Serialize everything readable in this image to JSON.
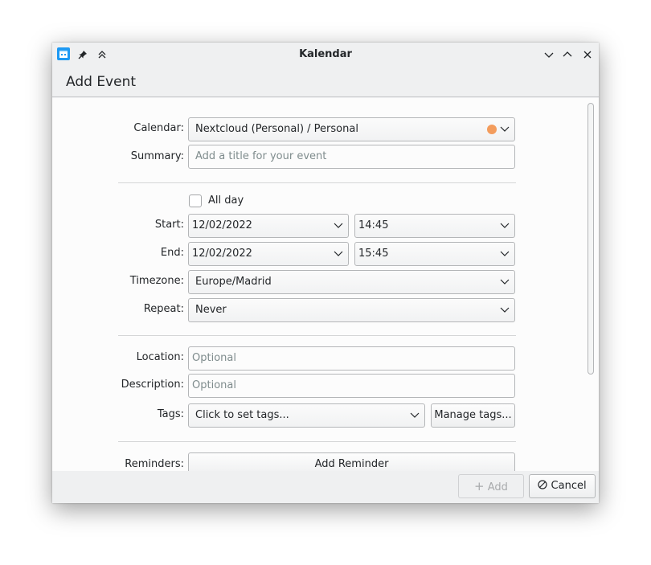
{
  "window": {
    "title": "Kalendar"
  },
  "header": {
    "title": "Add Event"
  },
  "form": {
    "calendar": {
      "label": "Calendar:",
      "value": "Nextcloud (Personal) / Personal",
      "color": "#f39c5c"
    },
    "summary": {
      "label": "Summary:",
      "placeholder": "Add a title for your event"
    },
    "all_day": {
      "label": "All day",
      "checked": false
    },
    "start": {
      "label": "Start:",
      "date": "12/02/2022",
      "time": "14:45"
    },
    "end": {
      "label": "End:",
      "date": "12/02/2022",
      "time": "15:45"
    },
    "timezone": {
      "label": "Timezone:",
      "value": "Europe/Madrid"
    },
    "repeat": {
      "label": "Repeat:",
      "value": "Never"
    },
    "location": {
      "label": "Location:",
      "placeholder": "Optional"
    },
    "description": {
      "label": "Description:",
      "placeholder": "Optional"
    },
    "tags": {
      "label": "Tags:",
      "value": "Click to set tags...",
      "manage_label": "Manage tags..."
    },
    "reminders": {
      "label": "Reminders:",
      "add_label": "Add Reminder"
    }
  },
  "footer": {
    "add_label": "Add",
    "cancel_label": "Cancel"
  },
  "colors": {
    "accent": "#3daee9",
    "window_bg": "#eff0f1",
    "field_border": "#b4b6b8"
  }
}
